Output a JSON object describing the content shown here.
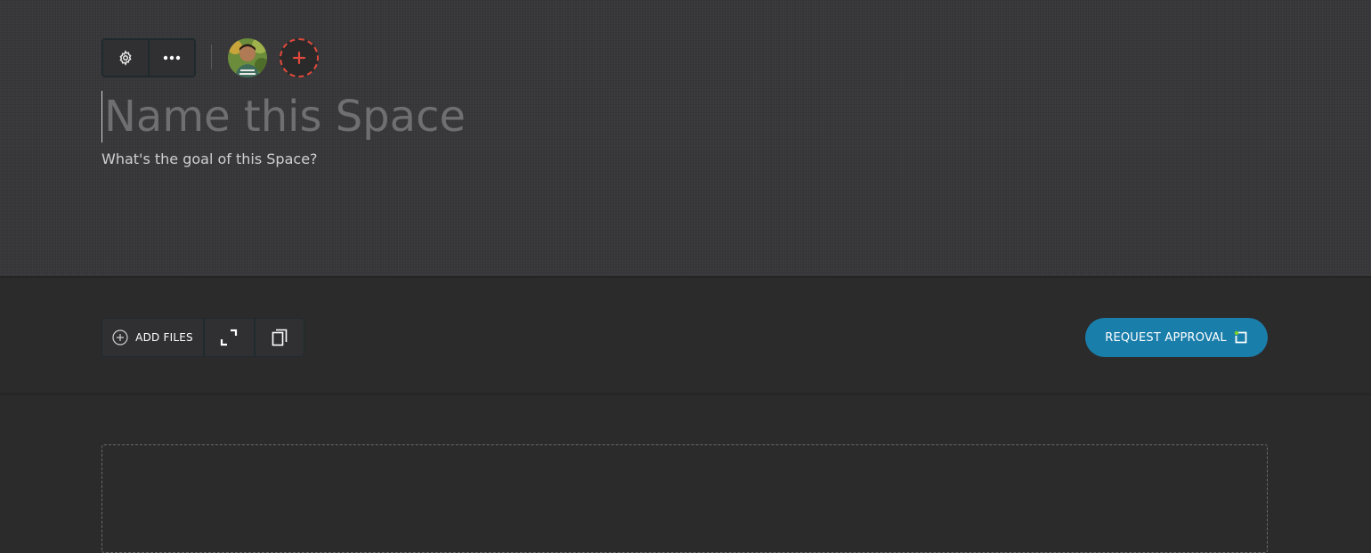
{
  "space": {
    "title_placeholder": "Name this Space",
    "goal_placeholder": "What's the goal of this Space?"
  },
  "header_controls": {
    "settings_icon": "gear-icon",
    "more_icon": "more-horizontal-icon",
    "add_member_icon": "plus-icon"
  },
  "toolbar": {
    "add_files_label": "ADD FILES",
    "expand_icon": "expand-icon",
    "copy_icon": "copy-icon"
  },
  "approval": {
    "request_label": "REQUEST APPROVAL",
    "icon": "approval-icon"
  },
  "colors": {
    "header_bg": "#383739",
    "body_bg": "#2b2b2c",
    "accent_blue": "#1a7eab",
    "add_member_red": "#e0493c",
    "approval_dot": "#7ed321"
  }
}
